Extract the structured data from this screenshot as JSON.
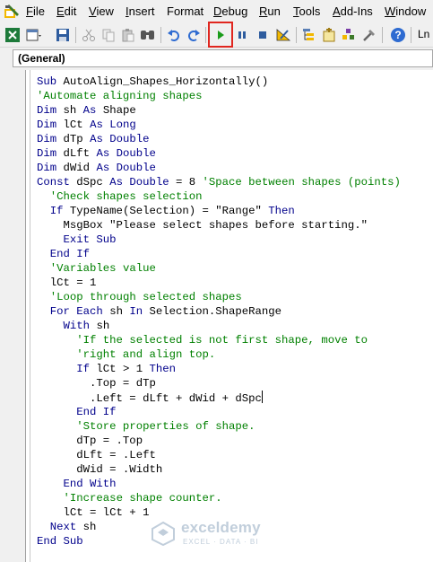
{
  "menubar": {
    "items": [
      {
        "label": "File",
        "accel": "F",
        "rest": "ile"
      },
      {
        "label": "Edit",
        "accel": "E",
        "rest": "dit"
      },
      {
        "label": "View",
        "accel": "V",
        "rest": "iew"
      },
      {
        "label": "Insert",
        "accel": "I",
        "rest": "nsert"
      },
      {
        "label": "Format",
        "accel": "",
        "rest": "Format"
      },
      {
        "label": "Debug",
        "accel": "D",
        "rest": "ebug"
      },
      {
        "label": "Run",
        "accel": "R",
        "rest": "un"
      },
      {
        "label": "Tools",
        "accel": "T",
        "rest": "ools"
      },
      {
        "label": "Add-Ins",
        "accel": "A",
        "rest": "dd-Ins"
      },
      {
        "label": "Window",
        "accel": "W",
        "rest": "indow"
      }
    ]
  },
  "toolbar": {
    "ln_label": "Ln",
    "icons": [
      "excel-view-icon",
      "insert-userform-icon",
      "save-icon",
      "cut-icon",
      "copy-icon",
      "paste-icon",
      "find-icon",
      "undo-icon",
      "redo-icon",
      "run-icon",
      "break-icon",
      "reset-icon",
      "design-mode-icon",
      "project-explorer-icon",
      "properties-window-icon",
      "object-browser-icon",
      "toolbox-icon",
      "help-icon"
    ],
    "highlight_color": "#e0261f"
  },
  "object_dropdown": {
    "value": "(General)"
  },
  "colors": {
    "keyword": "#00008b",
    "comment": "#008000",
    "text": "#000000",
    "run_green": "#1a9b1a"
  },
  "code": {
    "lines": [
      [
        {
          "t": "kw",
          "v": "Sub "
        },
        {
          "t": "tx",
          "v": "AutoAlign_Shapes_Horizontally()"
        }
      ],
      [
        {
          "t": "cm",
          "v": "'Automate aligning shapes"
        }
      ],
      [
        {
          "t": "kw",
          "v": "Dim "
        },
        {
          "t": "tx",
          "v": "sh "
        },
        {
          "t": "kw",
          "v": "As "
        },
        {
          "t": "tx",
          "v": "Shape"
        }
      ],
      [
        {
          "t": "kw",
          "v": "Dim "
        },
        {
          "t": "tx",
          "v": "lCt "
        },
        {
          "t": "kw",
          "v": "As Long"
        }
      ],
      [
        {
          "t": "kw",
          "v": "Dim "
        },
        {
          "t": "tx",
          "v": "dTp "
        },
        {
          "t": "kw",
          "v": "As Double"
        }
      ],
      [
        {
          "t": "kw",
          "v": "Dim "
        },
        {
          "t": "tx",
          "v": "dLft "
        },
        {
          "t": "kw",
          "v": "As Double"
        }
      ],
      [
        {
          "t": "kw",
          "v": "Dim "
        },
        {
          "t": "tx",
          "v": "dWid "
        },
        {
          "t": "kw",
          "v": "As Double"
        }
      ],
      [
        {
          "t": "kw",
          "v": "Const "
        },
        {
          "t": "tx",
          "v": "dSpc "
        },
        {
          "t": "kw",
          "v": "As Double"
        },
        {
          "t": "tx",
          "v": " = 8 "
        },
        {
          "t": "cm",
          "v": "'Space between shapes (points)"
        }
      ],
      [
        {
          "t": "tx",
          "v": "  "
        },
        {
          "t": "cm",
          "v": "'Check shapes selection"
        }
      ],
      [
        {
          "t": "tx",
          "v": "  "
        },
        {
          "t": "kw",
          "v": "If "
        },
        {
          "t": "tx",
          "v": "TypeName(Selection) = \"Range\" "
        },
        {
          "t": "kw",
          "v": "Then"
        }
      ],
      [
        {
          "t": "tx",
          "v": "    MsgBox \"Please select shapes before starting.\""
        }
      ],
      [
        {
          "t": "tx",
          "v": "    "
        },
        {
          "t": "kw",
          "v": "Exit Sub"
        }
      ],
      [
        {
          "t": "tx",
          "v": "  "
        },
        {
          "t": "kw",
          "v": "End If"
        }
      ],
      [
        {
          "t": "tx",
          "v": "  "
        },
        {
          "t": "cm",
          "v": "'Variables value"
        }
      ],
      [
        {
          "t": "tx",
          "v": "  lCt = 1"
        }
      ],
      [
        {
          "t": "tx",
          "v": "  "
        },
        {
          "t": "cm",
          "v": "'Loop through selected shapes"
        }
      ],
      [
        {
          "t": "tx",
          "v": "  "
        },
        {
          "t": "kw",
          "v": "For Each "
        },
        {
          "t": "tx",
          "v": "sh "
        },
        {
          "t": "kw",
          "v": "In "
        },
        {
          "t": "tx",
          "v": "Selection.ShapeRange"
        }
      ],
      [
        {
          "t": "tx",
          "v": "    "
        },
        {
          "t": "kw",
          "v": "With "
        },
        {
          "t": "tx",
          "v": "sh"
        }
      ],
      [
        {
          "t": "tx",
          "v": "      "
        },
        {
          "t": "cm",
          "v": "'If the selected is not first shape, move to"
        }
      ],
      [
        {
          "t": "tx",
          "v": "      "
        },
        {
          "t": "cm",
          "v": "'right and align top."
        }
      ],
      [
        {
          "t": "tx",
          "v": "      "
        },
        {
          "t": "kw",
          "v": "If "
        },
        {
          "t": "tx",
          "v": "lCt > 1 "
        },
        {
          "t": "kw",
          "v": "Then"
        }
      ],
      [
        {
          "t": "tx",
          "v": "        .Top = dTp"
        }
      ],
      [
        {
          "t": "tx",
          "v": "        .Left = dLft + dWid + dSpc"
        }
      ],
      [
        {
          "t": "tx",
          "v": "      "
        },
        {
          "t": "kw",
          "v": "End If"
        }
      ],
      [
        {
          "t": "tx",
          "v": "      "
        },
        {
          "t": "cm",
          "v": "'Store properties of shape."
        }
      ],
      [
        {
          "t": "tx",
          "v": "      dTp = .Top"
        }
      ],
      [
        {
          "t": "tx",
          "v": "      dLft = .Left"
        }
      ],
      [
        {
          "t": "tx",
          "v": "      dWid = .Width"
        }
      ],
      [
        {
          "t": "tx",
          "v": "    "
        },
        {
          "t": "kw",
          "v": "End With"
        }
      ],
      [
        {
          "t": "tx",
          "v": "    "
        },
        {
          "t": "cm",
          "v": "'Increase shape counter."
        }
      ],
      [
        {
          "t": "tx",
          "v": "    lCt = lCt + 1"
        }
      ],
      [
        {
          "t": "tx",
          "v": "  "
        },
        {
          "t": "kw",
          "v": "Next "
        },
        {
          "t": "tx",
          "v": "sh"
        }
      ],
      [
        {
          "t": "kw",
          "v": "End Sub"
        }
      ]
    ],
    "caret_line": 22
  },
  "watermark": {
    "name": "exceldemy",
    "tagline": "EXCEL · DATA · BI"
  }
}
